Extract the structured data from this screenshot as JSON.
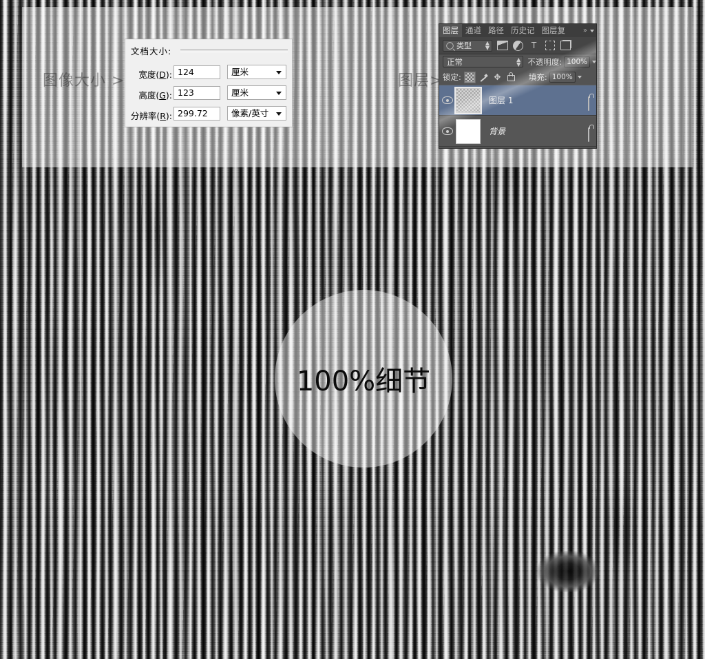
{
  "canvas": {
    "background_description": "grayscale vertical bark texture",
    "overlay_band_color": "#ffffff"
  },
  "watermarks": {
    "image_size": "图像大小 >",
    "layers": "图层>"
  },
  "image_size_dialog": {
    "group_title": "文档大小:",
    "fields": [
      {
        "label_prefix": "宽度(",
        "label_key": "D",
        "label_suffix": "):",
        "value": "124",
        "unit": "厘米"
      },
      {
        "label_prefix": "高度(",
        "label_key": "G",
        "label_suffix": "):",
        "value": "123",
        "unit": "厘米"
      },
      {
        "label_prefix": "分辨率(",
        "label_key": "R",
        "label_suffix": "):",
        "value": "299.72",
        "unit": "像素/英寸"
      }
    ]
  },
  "layers_panel": {
    "tabs": [
      {
        "label": "图层",
        "active": true
      },
      {
        "label": "通道",
        "active": false
      },
      {
        "label": "路径",
        "active": false
      },
      {
        "label": "历史记",
        "active": false
      },
      {
        "label": "图层复",
        "active": false
      }
    ],
    "collapse_icon": "»",
    "filter_row": {
      "search_icon": "search-icon",
      "type_label": "类型",
      "icons": [
        "pixel-layer-icon",
        "adjustment-layer-icon",
        "type-layer-icon",
        "shape-layer-icon",
        "smart-object-icon"
      ]
    },
    "blend_row": {
      "blend_mode": "正常",
      "opacity_label": "不透明度:",
      "opacity_value": "100%"
    },
    "lock_row": {
      "lock_label": "锁定:",
      "icons": [
        "lock-transparent-pixels-icon",
        "lock-image-pixels-icon",
        "lock-position-icon",
        "lock-all-icon"
      ],
      "fill_label": "填充:",
      "fill_value": "100%"
    },
    "layers": [
      {
        "name": "图层 1",
        "selected": true,
        "visible": true,
        "thumb": "checker",
        "italic": false,
        "locked": true
      },
      {
        "name": "背景",
        "selected": false,
        "visible": true,
        "thumb": "white",
        "italic": true,
        "locked": true
      }
    ]
  },
  "detail_callout": {
    "text": "100%细节"
  }
}
